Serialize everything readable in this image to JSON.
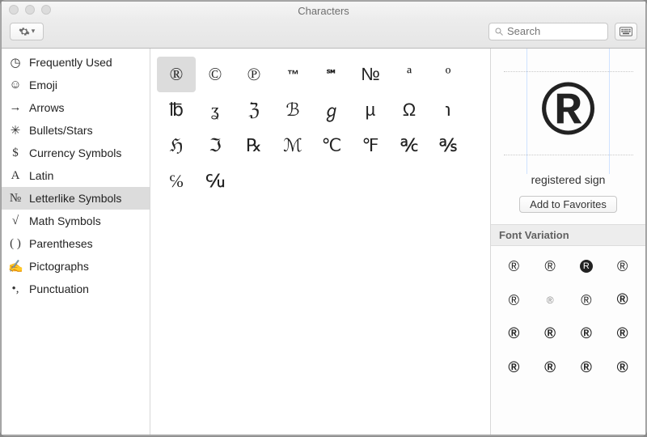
{
  "window_title": "Characters",
  "search": {
    "placeholder": "Search",
    "value": ""
  },
  "sidebar": {
    "items": [
      {
        "icon": "◷",
        "label": "Frequently Used"
      },
      {
        "icon": "☺",
        "label": "Emoji"
      },
      {
        "icon": "→",
        "label": "Arrows"
      },
      {
        "icon": "✳",
        "label": "Bullets/Stars"
      },
      {
        "icon": "$",
        "label": "Currency Symbols"
      },
      {
        "icon": "A",
        "label": "Latin"
      },
      {
        "icon": "№",
        "label": "Letterlike Symbols"
      },
      {
        "icon": "√",
        "label": "Math Symbols"
      },
      {
        "icon": "( )",
        "label": "Parentheses"
      },
      {
        "icon": "✍",
        "label": "Pictographs"
      },
      {
        "icon": "•,",
        "label": "Punctuation"
      }
    ],
    "selected_index": 6
  },
  "characters": [
    "®",
    "©",
    "℗",
    "™",
    "℠",
    "№",
    "ª",
    "º",
    "℔",
    "ʓ",
    "ℨ",
    "ℬ",
    "ℊ",
    "µ",
    "Ω",
    "℩",
    "ℌ",
    "ℑ",
    "℞",
    "ℳ",
    "℃",
    "℉",
    "℀",
    "℁",
    "℅",
    "℆"
  ],
  "selected_character_index": 0,
  "preview": {
    "glyph": "®",
    "name": "registered sign",
    "favorites_button": "Add to Favorites"
  },
  "variation": {
    "heading": "Font Variation",
    "cells": [
      "®",
      "®",
      "●R",
      "®",
      "®",
      "®",
      "®",
      "®",
      "®",
      "®",
      "®",
      "®",
      "®",
      "®",
      "®",
      "®"
    ]
  }
}
